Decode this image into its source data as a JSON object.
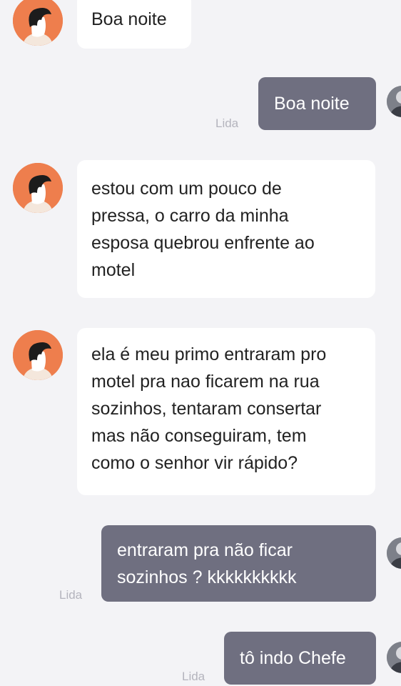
{
  "messages": [
    {
      "from": "contact",
      "lines": [
        "Boa noite"
      ]
    },
    {
      "from": "me",
      "lines": [
        "Boa noite"
      ],
      "status": "Lida"
    },
    {
      "from": "contact",
      "lines": [
        "estou com um pouco de",
        "pressa, o carro da minha",
        "esposa quebrou  enfrente ao",
        "motel"
      ]
    },
    {
      "from": "contact",
      "lines": [
        "ela é meu primo entraram pro",
        "motel pra nao ficarem na rua",
        "sozinhos, tentaram consertar",
        "mas não conseguiram, tem",
        "como o senhor vir rápido?"
      ]
    },
    {
      "from": "me",
      "lines": [
        "entraram pra não  ficar",
        "sozinhos ? kkkkkkkkkk"
      ],
      "status": "Lida"
    },
    {
      "from": "me",
      "lines": [
        "tô indo Chefe"
      ],
      "status": "Lida"
    }
  ],
  "colors": {
    "background": "#f3f3f6",
    "incoming_bubble": "#ffffff",
    "outgoing_bubble": "#6f6f80",
    "avatar": "#ee7e4d",
    "read_status": "#b4b4bd"
  },
  "icons": {
    "incoming_avatar": "person-silhouette-avatar",
    "outgoing_avatar": "person-avatar"
  }
}
